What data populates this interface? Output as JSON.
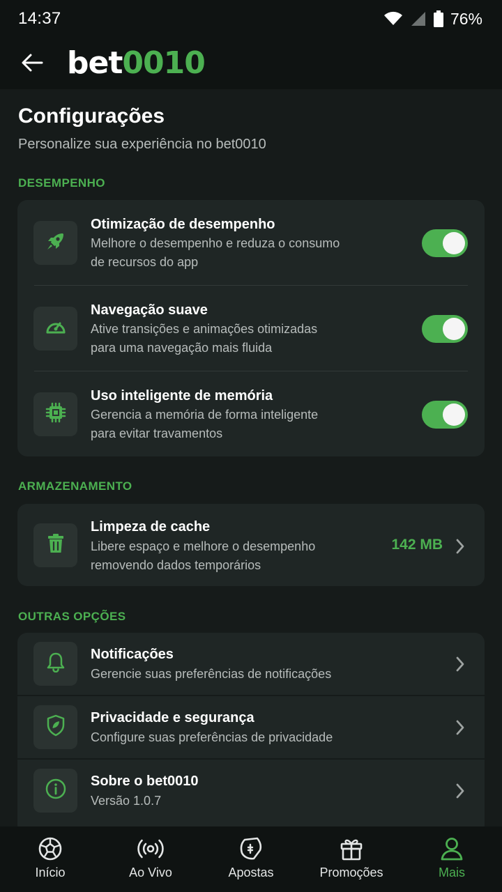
{
  "status_bar": {
    "time": "14:37",
    "battery_percent": "76%",
    "icons": [
      "wifi-icon",
      "cell-signal-icon",
      "battery-icon"
    ]
  },
  "header": {
    "back_icon": "arrow-left-icon",
    "logo_white": "bet",
    "logo_green": "0010"
  },
  "page": {
    "title": "Configurações",
    "subtitle": "Personalize sua experiência no bet0010"
  },
  "sections": {
    "performance": {
      "label": "DESEMPENHO",
      "items": [
        {
          "icon": "rocket-icon",
          "title": "Otimização de desempenho",
          "desc_line1": "Melhore o desempenho e reduza o consumo",
          "desc_line2": "de recursos do app",
          "enabled": true
        },
        {
          "icon": "speedometer-icon",
          "title": "Navegação suave",
          "desc_line1": "Ative transições e animações otimizadas",
          "desc_line2": "para uma navegação mais fluida",
          "enabled": true
        },
        {
          "icon": "chip-icon",
          "title": "Uso inteligente de memória",
          "desc_line1": "Gerencia a memória de forma inteligente",
          "desc_line2": "para evitar travamentos",
          "enabled": true
        }
      ]
    },
    "storage": {
      "label": "ARMAZENAMENTO",
      "items": [
        {
          "icon": "trash-icon",
          "title": "Limpeza de cache",
          "desc_line1": "Libere espaço e melhore o desempenho",
          "desc_line2": "removendo dados temporários",
          "value": "142 MB"
        }
      ]
    },
    "other": {
      "label": "OUTRAS OPÇÕES",
      "items": [
        {
          "icon": "bell-icon",
          "title": "Notificações",
          "desc": "Gerencie suas preferências de notificações"
        },
        {
          "icon": "shield-icon",
          "title": "Privacidade e segurança",
          "desc": "Configure suas preferências de privacidade"
        },
        {
          "icon": "info-icon",
          "title": "Sobre o bet0010",
          "desc": "Versão 1.0.7"
        }
      ]
    }
  },
  "bottom_nav": {
    "items": [
      {
        "icon": "soccer-ball-icon",
        "label": "Início"
      },
      {
        "icon": "live-broadcast-icon",
        "label": "Ao Vivo"
      },
      {
        "icon": "ticket-icon",
        "label": "Apostas"
      },
      {
        "icon": "gift-icon",
        "label": "Promoções"
      },
      {
        "icon": "user-icon",
        "label": "Mais"
      }
    ],
    "active": "Mais"
  },
  "colors": {
    "accent": "#4cb051",
    "background": "#161b1a",
    "card": "#1f2625",
    "bar": "#0f1312"
  }
}
